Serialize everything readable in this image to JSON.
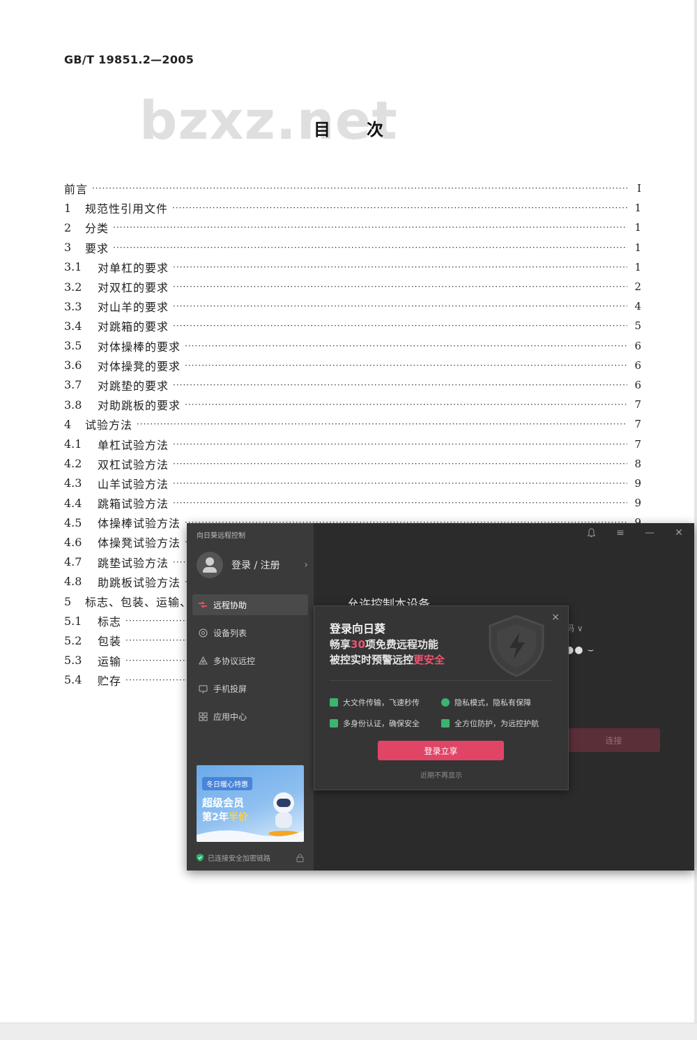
{
  "document": {
    "std_code": "GB/T 19851.2—2005",
    "watermark": "bzxz.net",
    "toc_title": "目次",
    "toc": [
      {
        "num": "",
        "label": "前言",
        "page": "Ⅰ"
      },
      {
        "num": "1  ",
        "label": "规范性引用文件",
        "page": "1"
      },
      {
        "num": "2  ",
        "label": "分类",
        "page": "1"
      },
      {
        "num": "3  ",
        "label": "要求",
        "page": "1"
      },
      {
        "num": "3.1  ",
        "label": "对单杠的要求",
        "page": "1"
      },
      {
        "num": "3.2  ",
        "label": "对双杠的要求",
        "page": "2"
      },
      {
        "num": "3.3  ",
        "label": "对山羊的要求",
        "page": "4"
      },
      {
        "num": "3.4  ",
        "label": "对跳箱的要求",
        "page": "5"
      },
      {
        "num": "3.5  ",
        "label": "对体操棒的要求",
        "page": "6"
      },
      {
        "num": "3.6  ",
        "label": "对体操凳的要求",
        "page": "6"
      },
      {
        "num": "3.7  ",
        "label": "对跳垫的要求",
        "page": "6"
      },
      {
        "num": "3.8  ",
        "label": "对助跳板的要求",
        "page": "7"
      },
      {
        "num": "4  ",
        "label": "试验方法",
        "page": "7"
      },
      {
        "num": "4.1  ",
        "label": "单杠试验方法",
        "page": "7"
      },
      {
        "num": "4.2  ",
        "label": "双杠试验方法",
        "page": "8"
      },
      {
        "num": "4.3  ",
        "label": "山羊试验方法",
        "page": "9"
      },
      {
        "num": "4.4  ",
        "label": "跳箱试验方法",
        "page": "9"
      },
      {
        "num": "4.5  ",
        "label": "体操棒试验方法",
        "page": "9"
      },
      {
        "num": "4.6  ",
        "label": "体操凳试验方法",
        "page": ""
      },
      {
        "num": "4.7  ",
        "label": "跳垫试验方法",
        "page": ""
      },
      {
        "num": "4.8  ",
        "label": "助跳板试验方法",
        "page": ""
      },
      {
        "num": "5  ",
        "label": "标志、包装、运输、贮存",
        "page": ""
      },
      {
        "num": "5.1  ",
        "label": "标志",
        "page": ""
      },
      {
        "num": "5.2  ",
        "label": "包装",
        "page": ""
      },
      {
        "num": "5.3  ",
        "label": "运输",
        "page": ""
      },
      {
        "num": "5.4  ",
        "label": "贮存",
        "page": ""
      }
    ]
  },
  "remote_app": {
    "window_title": "向日葵远程控制",
    "user_label": "登录 / 注册",
    "nav": [
      {
        "label": "远程协助",
        "icon": "remote-assist-icon",
        "active": true
      },
      {
        "label": "设备列表",
        "icon": "device-list-icon",
        "active": false
      },
      {
        "label": "多协议远控",
        "icon": "multi-protocol-icon",
        "active": false
      },
      {
        "label": "手机投屏",
        "icon": "phone-cast-icon",
        "active": false
      },
      {
        "label": "应用中心",
        "icon": "app-center-icon",
        "active": false
      }
    ],
    "promo": {
      "tag": "冬日暖心特惠",
      "line1": "超级会员",
      "line2_prefix": "第2年",
      "line2_highlight": "半价"
    },
    "secure_status": "已连接安全加密链路",
    "main_heading": "允许控制本设备",
    "code_label": "码 ∨",
    "password_mask": "●● ⌣",
    "connect_label": "连接",
    "accent_color": "#e04566"
  },
  "login_popup": {
    "title": "登录向日葵",
    "line2_prefix": "畅享",
    "line2_highlight": "30",
    "line2_suffix": "项免费远程功能",
    "line3_prefix": "被控实时预警远控",
    "line3_highlight": "更安全",
    "features": [
      {
        "text": "大文件传输，飞速秒传",
        "icon": "folder-icon",
        "color": "#3cb371"
      },
      {
        "text": "隐私模式，隐私有保障",
        "icon": "privacy-icon",
        "color": "#3cb371"
      },
      {
        "text": "多身份认证，确保安全",
        "icon": "identity-icon",
        "color": "#3cb371"
      },
      {
        "text": "全方位防护，为远控护航",
        "icon": "shield-check-icon",
        "color": "#3cb371"
      }
    ],
    "login_button": "登录立享",
    "dismiss_link": "近期不再显示",
    "close_glyph": "×"
  }
}
